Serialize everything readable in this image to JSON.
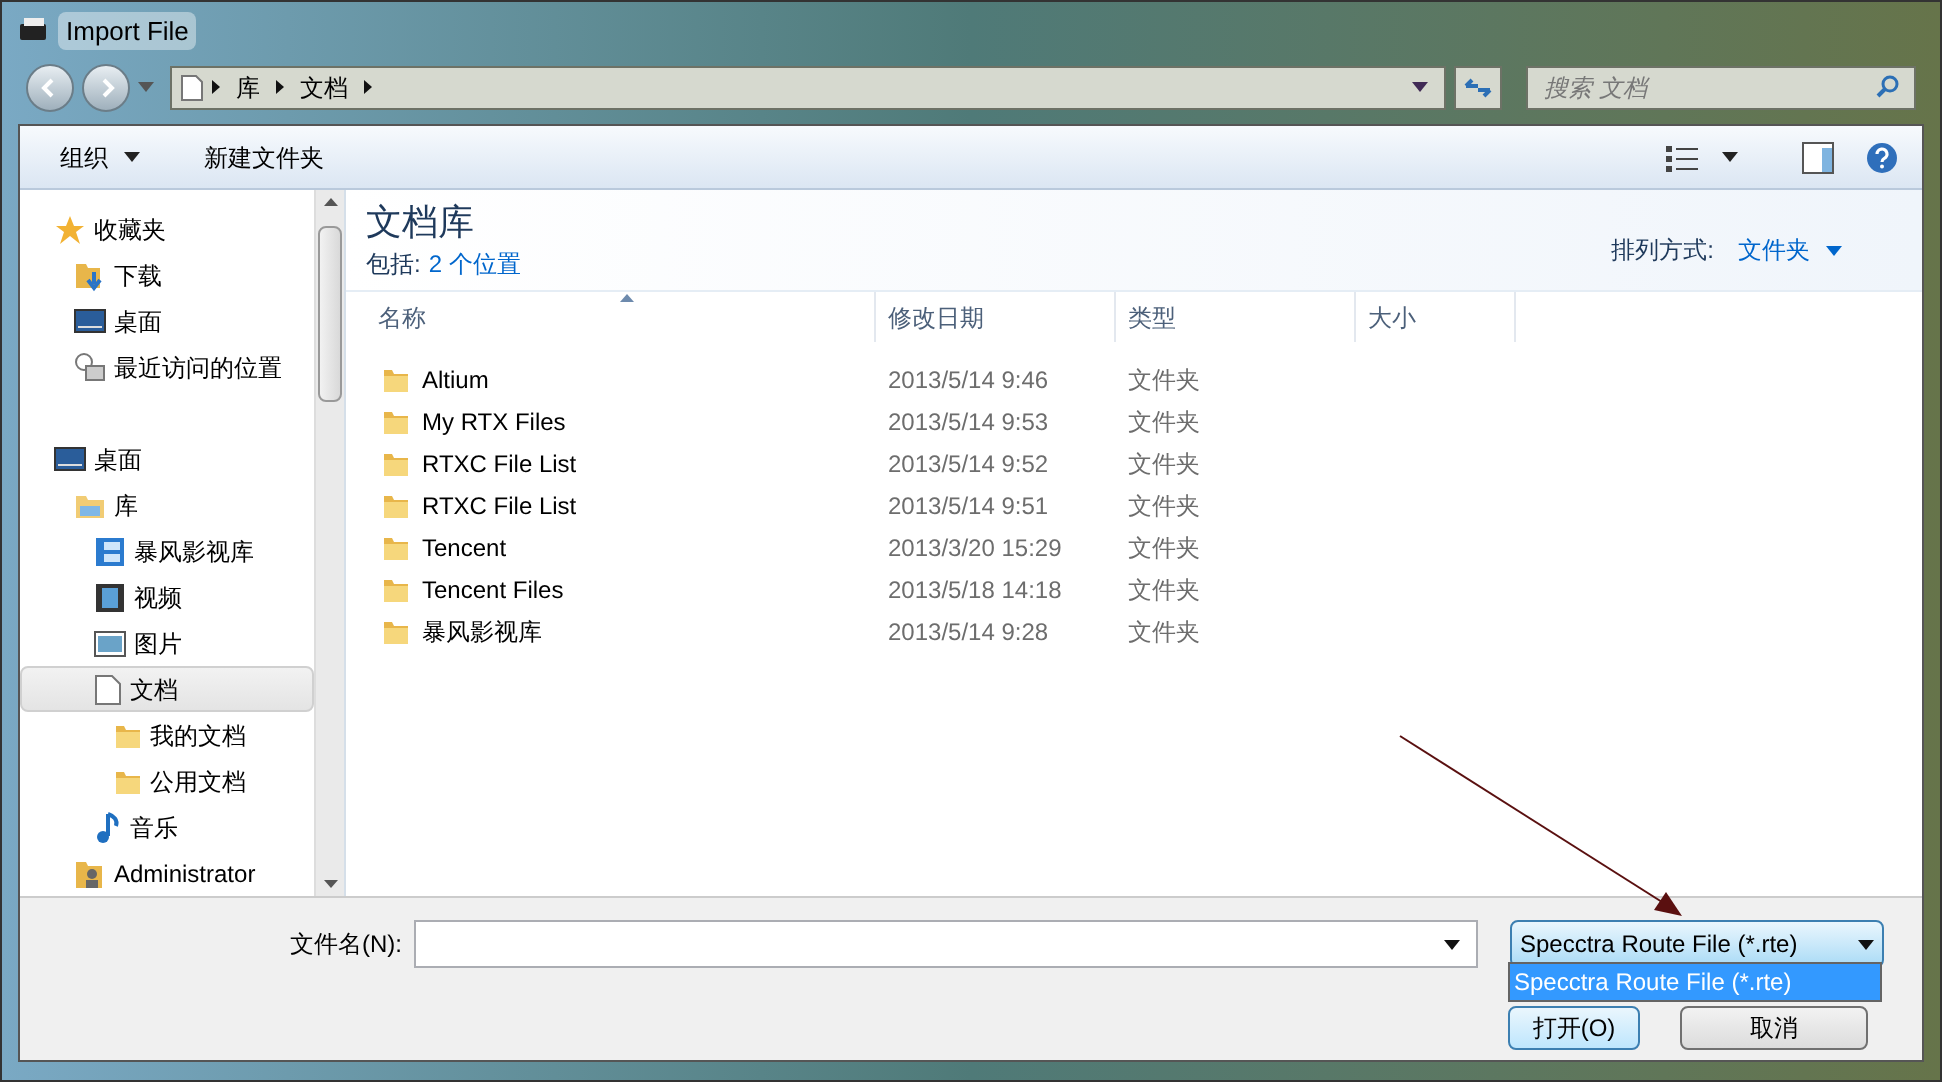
{
  "window": {
    "title": "Import File"
  },
  "breadcrumb": [
    "库",
    "文档"
  ],
  "search": {
    "placeholder": "搜索 文档"
  },
  "toolbar": {
    "organize": "组织",
    "new_folder": "新建文件夹"
  },
  "sidebar": {
    "items": [
      {
        "label": "收藏夹",
        "kind": "star",
        "selected": false,
        "children": [
          {
            "label": "下载",
            "kind": "download",
            "selected": false
          },
          {
            "label": "桌面",
            "kind": "desktop",
            "selected": false
          },
          {
            "label": "最近访问的位置",
            "kind": "recent",
            "selected": false
          }
        ]
      },
      {
        "label": "桌面",
        "kind": "desktop",
        "selected": false,
        "children": [
          {
            "label": "库",
            "kind": "library",
            "selected": false,
            "children": [
              {
                "label": "暴风影视库",
                "kind": "media",
                "selected": false
              },
              {
                "label": "视频",
                "kind": "video",
                "selected": false
              },
              {
                "label": "图片",
                "kind": "picture",
                "selected": false
              },
              {
                "label": "文档",
                "kind": "document",
                "selected": true,
                "children": [
                  {
                    "label": "我的文档",
                    "kind": "folder",
                    "selected": false
                  },
                  {
                    "label": "公用文档",
                    "kind": "folder",
                    "selected": false
                  }
                ]
              },
              {
                "label": "音乐",
                "kind": "music",
                "selected": false
              }
            ]
          },
          {
            "label": "Administrator",
            "kind": "user",
            "selected": false
          }
        ]
      }
    ]
  },
  "library": {
    "title": "文档库",
    "includes_label": "包括:",
    "includes_link": "2 个位置",
    "arrange_label": "排列方式:",
    "arrange_value": "文件夹"
  },
  "table": {
    "columns": [
      {
        "label": "名称",
        "sorted": true
      },
      {
        "label": "修改日期",
        "sorted": false
      },
      {
        "label": "类型",
        "sorted": false
      },
      {
        "label": "大小",
        "sorted": false
      }
    ],
    "rows": [
      {
        "name": "Altium",
        "modified": "2013/5/14 9:46",
        "type": "文件夹"
      },
      {
        "name": "My RTX Files",
        "modified": "2013/5/14 9:53",
        "type": "文件夹"
      },
      {
        "name": "RTXC File List",
        "modified": "2013/5/14 9:52",
        "type": "文件夹"
      },
      {
        "name": "RTXC File List",
        "modified": "2013/5/14 9:51",
        "type": "文件夹"
      },
      {
        "name": "Tencent",
        "modified": "2013/3/20 15:29",
        "type": "文件夹"
      },
      {
        "name": "Tencent Files",
        "modified": "2013/5/18 14:18",
        "type": "文件夹"
      },
      {
        "name": "暴风影视库",
        "modified": "2013/5/14 9:28",
        "type": "文件夹"
      }
    ]
  },
  "filename": {
    "label": "文件名(N):"
  },
  "file_type": {
    "value": "Specctra Route File (*.rte)",
    "expanded": true,
    "options": [
      {
        "label": "Specctra Route File (*.rte)",
        "selected": true
      }
    ]
  },
  "buttons": [
    "打开(O)",
    "取消"
  ]
}
